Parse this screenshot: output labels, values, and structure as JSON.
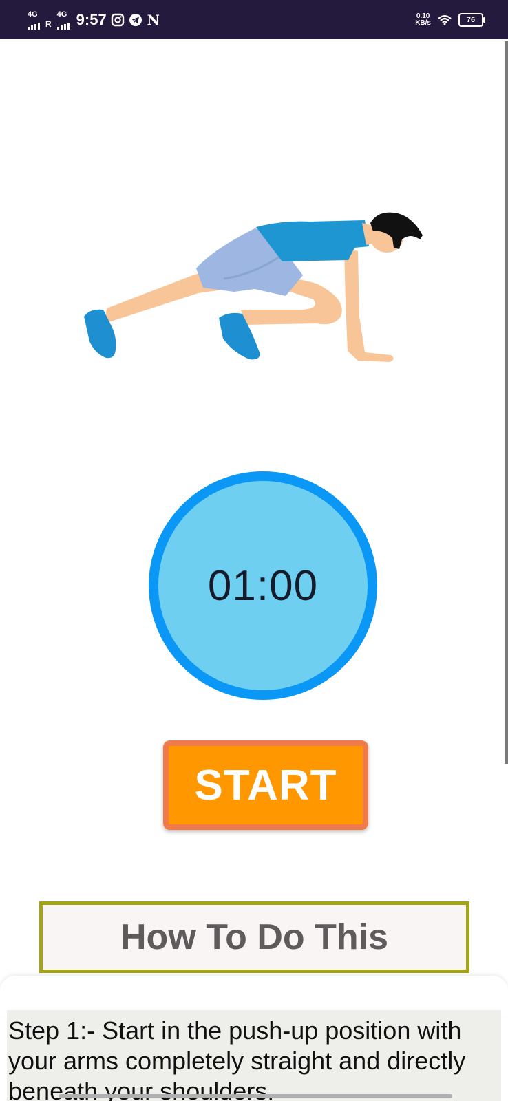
{
  "status_bar": {
    "network1": "4G",
    "roaming": "R",
    "network2": "4G",
    "time": "9:57",
    "speed_value": "0.10",
    "speed_unit": "KB/s",
    "battery": "76",
    "icons": [
      "instagram-icon",
      "telegram-icon",
      "netflix-n-icon",
      "wifi-icon",
      "battery-icon"
    ]
  },
  "exercise": {
    "illustration": "mountain-climber-figure"
  },
  "timer": {
    "value": "01:00"
  },
  "start_button": {
    "label": "START"
  },
  "howto": {
    "label": "How To Do This"
  },
  "steps": {
    "text": "Step 1:- Start in the push-up position with your arms completely straight and directly beneath your shoulders."
  },
  "colors": {
    "status_bar_bg": "#241a3e",
    "timer_fill": "#6ecff0",
    "timer_ring": "#0a97f5",
    "start_bg": "#ff9800",
    "start_border": "#f07a4a",
    "howto_border": "#a4a31c",
    "shirt": "#1e96d1",
    "shorts": "#9db6e2",
    "skin": "#f7c597",
    "shoes": "#1e90d2"
  }
}
